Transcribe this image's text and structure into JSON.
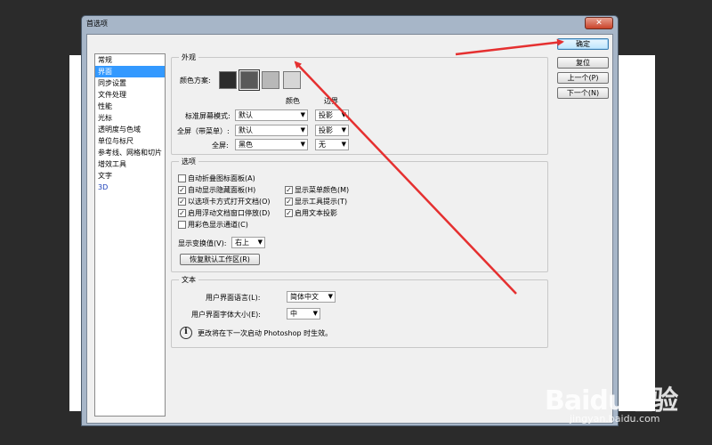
{
  "dialog": {
    "title": "首选项",
    "close_glyph": "✕"
  },
  "nav": {
    "items": [
      {
        "label": "常规"
      },
      {
        "label": "界面"
      },
      {
        "label": "同步设置"
      },
      {
        "label": "文件处理"
      },
      {
        "label": "性能"
      },
      {
        "label": "光标"
      },
      {
        "label": "透明度与色域"
      },
      {
        "label": "单位与标尺"
      },
      {
        "label": "参考线、网格和切片"
      },
      {
        "label": "增效工具"
      },
      {
        "label": "文字"
      },
      {
        "label": "3D"
      }
    ],
    "selected": "界面"
  },
  "appearance": {
    "legend": "外观",
    "color_scheme_label": "颜色方案:",
    "swatches": [
      "#2c2c2c",
      "#595959",
      "#b8b8b8",
      "#d6d6d6"
    ],
    "col_color": "颜色",
    "col_border": "边界",
    "rows": [
      {
        "label": "标准屏幕模式:",
        "color": "默认",
        "border": "投影"
      },
      {
        "label": "全屏（带菜单）:",
        "color": "默认",
        "border": "投影"
      },
      {
        "label": "全屏:",
        "color": "黑色",
        "border": "无"
      }
    ]
  },
  "options": {
    "legend": "选项",
    "left": [
      {
        "label": "自动折叠图标面板(A)",
        "checked": false
      },
      {
        "label": "自动显示隐藏面板(H)",
        "checked": true
      },
      {
        "label": "以选项卡方式打开文档(O)",
        "checked": true
      },
      {
        "label": "启用浮动文档窗口停放(D)",
        "checked": true
      },
      {
        "label": "用彩色显示通道(C)",
        "checked": false
      }
    ],
    "right": [
      {
        "label": "显示菜单颜色(M)",
        "checked": true
      },
      {
        "label": "显示工具提示(T)",
        "checked": true
      },
      {
        "label": "启用文本投影",
        "checked": true
      }
    ],
    "transform_label": "显示变换值(V):",
    "transform_value": "右上",
    "restore_button": "恢复默认工作区(R)"
  },
  "text_group": {
    "legend": "文本",
    "lang_label": "用户界面语言(L):",
    "lang_value": "简体中文",
    "size_label": "用户界面字体大小(E):",
    "size_value": "中",
    "note": "更改将在下一次启动 Photoshop 时生效。"
  },
  "buttons": {
    "ok": "确定",
    "reset": "复位",
    "prev": "上一个(P)",
    "next": "下一个(N)"
  },
  "watermark": {
    "brand": "Baidu经验",
    "url": "jingyan.baidu.com"
  },
  "annotation_color": "#e53030"
}
